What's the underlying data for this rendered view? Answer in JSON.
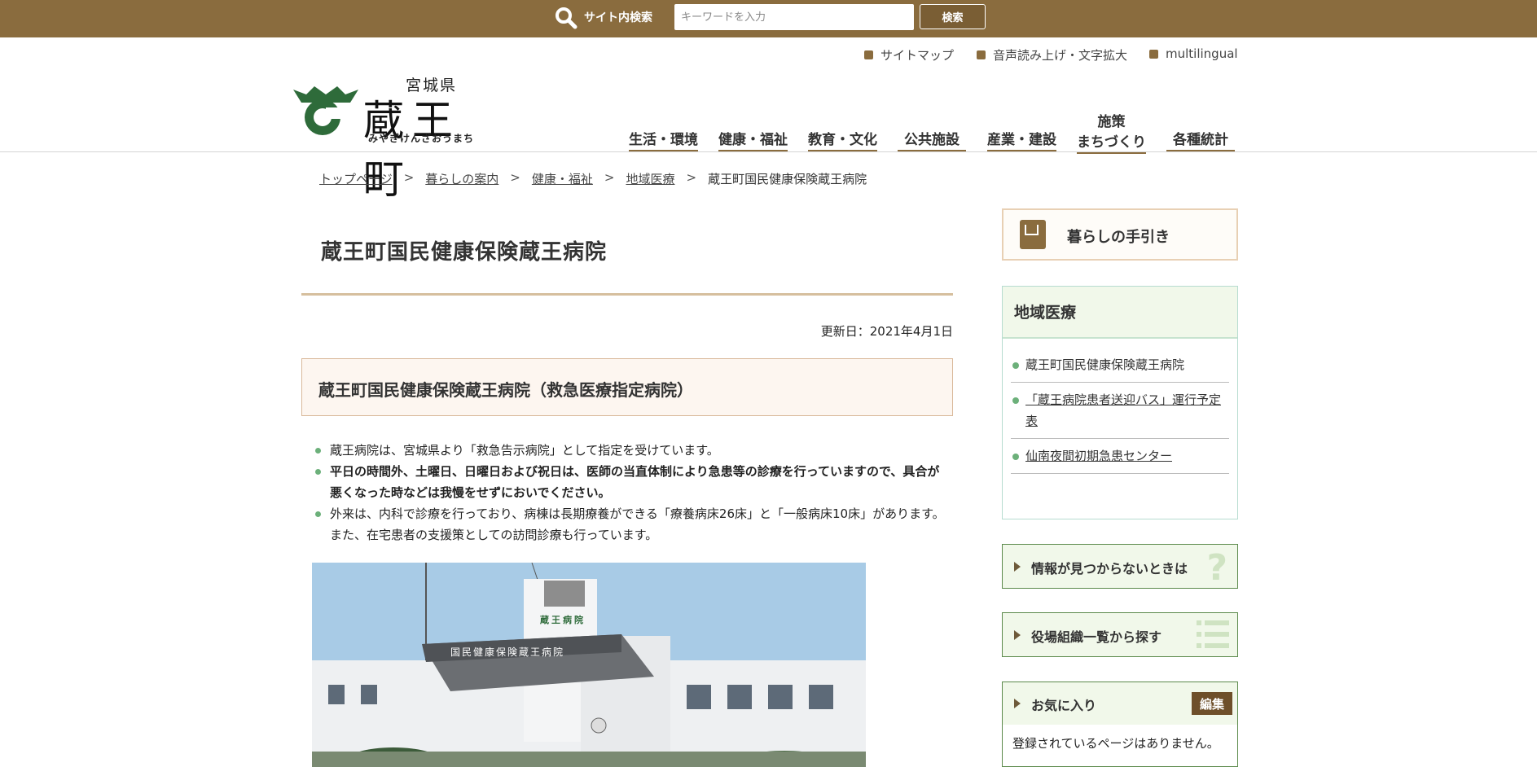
{
  "colors": {
    "brand": "#8a6c3e",
    "accent_green": "#6cb07a",
    "box_border": "#5b8a4b"
  },
  "search": {
    "label": "サイト内検索",
    "placeholder": "キーワードを入力",
    "button": "検索"
  },
  "utility_links": [
    "サイトマップ",
    "音声読み上げ・文字拡大",
    "multilingual"
  ],
  "logo": {
    "prefecture": "宮城県",
    "town": "蔵王町",
    "kana": "みやぎけんざおうまち"
  },
  "global_nav": [
    {
      "label": "生活・環境"
    },
    {
      "label": "健康・福祉"
    },
    {
      "label": "教育・文化"
    },
    {
      "label": "公共施設"
    },
    {
      "label": "産業・建設"
    },
    {
      "label_top": "施策",
      "label": "まちづくり"
    },
    {
      "label": "各種統計"
    }
  ],
  "breadcrumb": {
    "items": [
      "トップページ",
      "暮らしの案内",
      "健康・福祉",
      "地域医療"
    ],
    "current": "蔵王町国民健康保険蔵王病院",
    "separator": ">"
  },
  "main": {
    "title": "蔵王町国民健康保険蔵王病院",
    "updated": "更新日：2021年4月1日",
    "heading": "蔵王町国民健康保険蔵王病院（救急医療指定病院）",
    "bullets": [
      "蔵王病院は、宮城県より「救急告示病院」として指定を受けています。",
      "平日の時間外、土曜日、日曜日および祝日は、医師の当直体制により急患等の診療を行っていますので、具合が悪くなった時などは我慢をせずにおいでください。",
      "外来は、内科で診療を行っており、病棟は長期療養ができる「療養病床26床」と「一般病床10床」があります。また、在宅患者の支援策としての訪問診療も行っています。"
    ],
    "photo": {
      "building_sign": "国民健康保険蔵王病院",
      "tower_sign": "蔵王病院"
    }
  },
  "sidebar": {
    "guide": "暮らしの手引き",
    "local_medical": {
      "title": "地域医療",
      "items": [
        "蔵王町国民健康保険蔵王病院",
        "「蔵王病院患者送迎バス」運行予定表",
        "仙南夜間初期急患センター"
      ]
    },
    "not_found": "情報が見つからないときは",
    "org_list": "役場組織一覧から探す",
    "favorites": {
      "title": "お気に入り",
      "edit": "編集",
      "empty": "登録されているページはありません。"
    }
  }
}
